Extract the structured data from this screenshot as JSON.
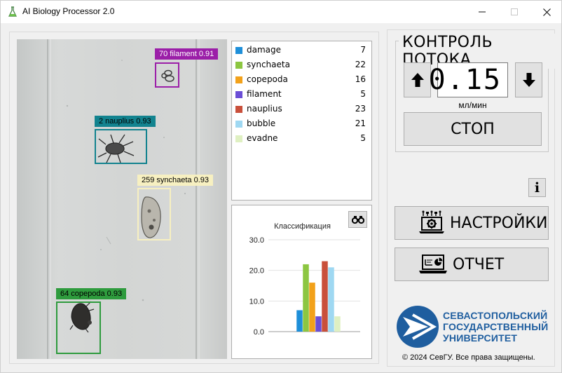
{
  "window": {
    "title": "AI Biology Processor 2.0"
  },
  "detections": [
    {
      "label": "70 filament 0.91",
      "color": "#9b1fa8",
      "text_color": "#ffffff"
    },
    {
      "label": "2 nauplius 0.93",
      "color": "#12838f",
      "text_color": "#000000"
    },
    {
      "label": "259 synchaeta 0.93",
      "color": "#f7f0c1",
      "text_color": "#000000"
    },
    {
      "label": "64 copepoda 0.93",
      "color": "#2e9b3d",
      "text_color": "#000000"
    }
  ],
  "legend": [
    {
      "name": "damage",
      "count": "7",
      "color": "#1e8fd9"
    },
    {
      "name": "synchaeta",
      "count": "22",
      "color": "#8cc641"
    },
    {
      "name": "copepoda",
      "count": "16",
      "color": "#f2a11a"
    },
    {
      "name": "filament",
      "count": "5",
      "color": "#6b4ed6"
    },
    {
      "name": "nauplius",
      "count": "23",
      "color": "#c9503b"
    },
    {
      "name": "bubble",
      "count": "21",
      "color": "#9fd8f2"
    },
    {
      "name": "evadne",
      "count": "5",
      "color": "#dff0c2"
    }
  ],
  "chart_data": {
    "type": "bar",
    "title": "Классификация",
    "categories": [
      "damage",
      "synchaeta",
      "copepoda",
      "filament",
      "nauplius",
      "bubble",
      "evadne"
    ],
    "values": [
      7,
      22,
      16,
      5,
      23,
      21,
      5
    ],
    "colors": [
      "#1e8fd9",
      "#8cc641",
      "#f2a11a",
      "#6b4ed6",
      "#c9503b",
      "#9fd8f2",
      "#dff0c2"
    ],
    "ylim": [
      0,
      30
    ],
    "yticks": [
      "0.0",
      "10.0",
      "20.0",
      "30.0"
    ],
    "grid": true,
    "legend": "none"
  },
  "flow": {
    "title": "КОНТРОЛЬ ПОТОКА",
    "value": "0.15",
    "unit": "мл/мин",
    "stop_label": "СТОП"
  },
  "buttons": {
    "settings_label": "НАСТРОЙКИ",
    "report_label": "ОТЧЕТ",
    "info_label": "i"
  },
  "university": {
    "line1": "СЕВАСТОПОЛЬСКИЙ",
    "line2": "ГОСУДАРСТВЕННЫЙ",
    "line3": "УНИВЕРСИТЕТ",
    "copyright": "© 2024 СевГУ. Все права защищены."
  }
}
